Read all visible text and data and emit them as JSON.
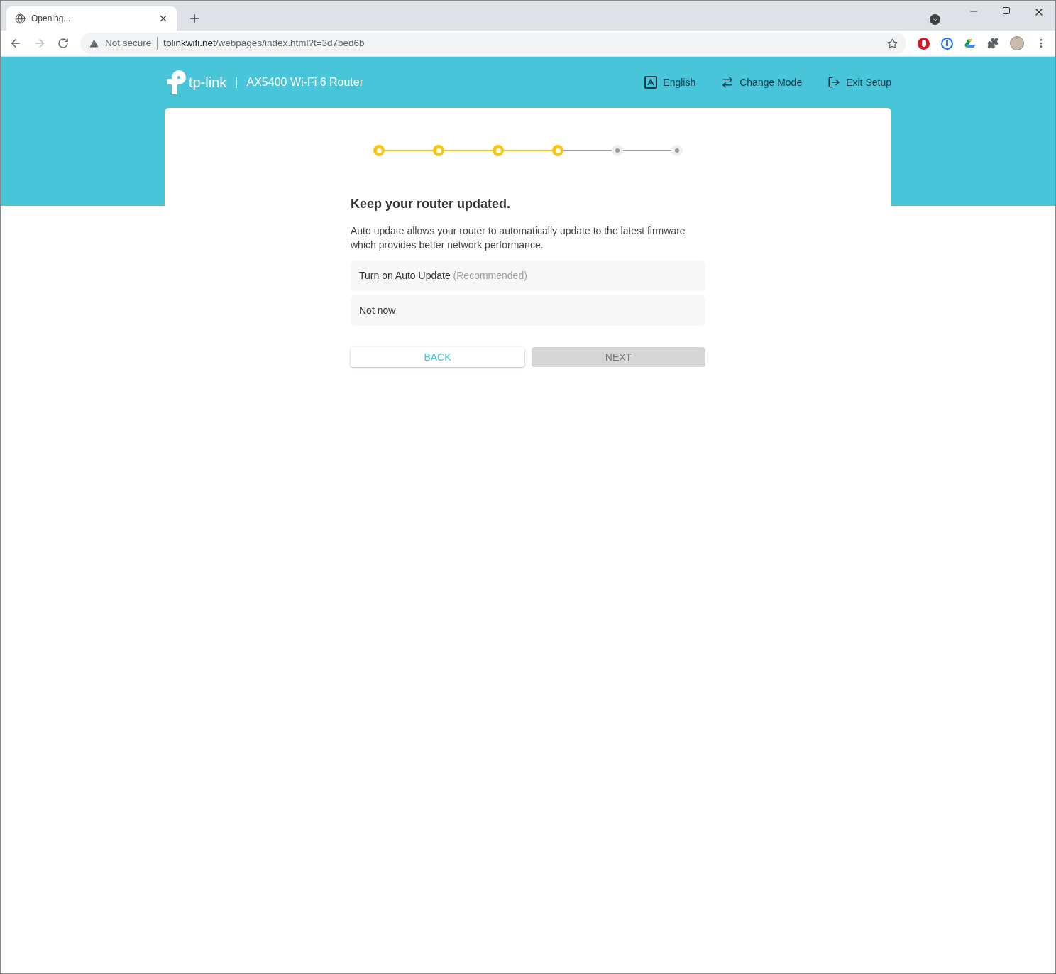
{
  "browser": {
    "tab": {
      "title": "Opening..."
    },
    "address": {
      "security": "Not secure",
      "host": "tplinkwifi.net",
      "path": "/webpages/index.html?t=3d7bed6b"
    }
  },
  "header": {
    "logo": "tp-link",
    "separator": "|",
    "model": "AX5400 Wi-Fi 6 Router",
    "actions": [
      {
        "kind": "language",
        "label": "English"
      },
      {
        "kind": "mode",
        "label": "Change Mode"
      },
      {
        "kind": "exit",
        "label": "Exit Setup"
      }
    ]
  },
  "steps": [
    {
      "done": true
    },
    {
      "done": true
    },
    {
      "done": true
    },
    {
      "done": true
    },
    {
      "done": false
    },
    {
      "done": false
    }
  ],
  "title": "Keep your router updated.",
  "description": "Auto update allows your router to automatically update to the latest firmware which provides better network performance.",
  "options": [
    {
      "label": "Turn on Auto Update",
      "note": "(Recommended)",
      "selected": false
    },
    {
      "label": "Not now",
      "selected": false
    }
  ],
  "buttons": [
    {
      "label": "BACK",
      "disabled": false
    },
    {
      "label": "NEXT",
      "disabled": true
    }
  ]
}
